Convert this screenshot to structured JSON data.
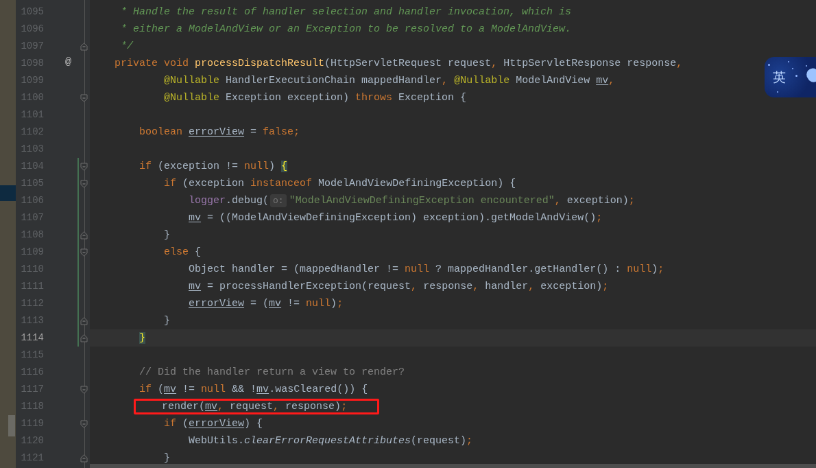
{
  "lines": [
    {
      "number": "1095",
      "tokens": [
        {
          "kind": "doc",
          "text": "     * Handle the result of handler selection and handler invocation, which is"
        }
      ]
    },
    {
      "number": "1096",
      "tokens": [
        {
          "kind": "doc",
          "text": "     * either a ModelAndView or an Exception to be resolved to a ModelAndView."
        }
      ]
    },
    {
      "number": "1097",
      "fold": {
        "kind": "end"
      },
      "tokens": [
        {
          "kind": "doc",
          "text": "     */"
        }
      ]
    },
    {
      "number": "1098",
      "marker": "@",
      "tokens": [
        {
          "kind": "keyword",
          "text": "    private void "
        },
        {
          "kind": "method",
          "text": "processDispatchResult"
        },
        {
          "kind": "plain",
          "text": "(HttpServletRequest request"
        },
        {
          "kind": "keyword",
          "text": ", "
        },
        {
          "kind": "plain",
          "text": "HttpServletResponse response"
        },
        {
          "kind": "keyword",
          "text": ","
        }
      ]
    },
    {
      "number": "1099",
      "tokens": [
        {
          "kind": "annotation",
          "text": "            @Nullable "
        },
        {
          "kind": "plain",
          "text": "HandlerExecutionChain mappedHandler"
        },
        {
          "kind": "keyword",
          "text": ", "
        },
        {
          "kind": "annotation",
          "text": "@Nullable "
        },
        {
          "kind": "plain",
          "text": "ModelAndView "
        },
        {
          "kind": "variable",
          "text": "mv"
        },
        {
          "kind": "keyword",
          "text": ","
        }
      ]
    },
    {
      "number": "1100",
      "fold": {
        "kind": "start"
      },
      "tokens": [
        {
          "kind": "annotation",
          "text": "            @Nullable "
        },
        {
          "kind": "plain",
          "text": "Exception exception) "
        },
        {
          "kind": "keyword",
          "text": "throws "
        },
        {
          "kind": "plain",
          "text": "Exception {"
        }
      ]
    },
    {
      "number": "1101"
    },
    {
      "number": "1102",
      "tokens": [
        {
          "kind": "keyword",
          "text": "        boolean "
        },
        {
          "kind": "variable",
          "text": "errorView"
        },
        {
          "kind": "plain",
          "text": " = "
        },
        {
          "kind": "keyword",
          "text": "false;"
        }
      ]
    },
    {
      "number": "1103"
    },
    {
      "number": "1104",
      "fold": {
        "kind": "start"
      },
      "changed": true,
      "tokens": [
        {
          "kind": "keyword",
          "text": "        if "
        },
        {
          "kind": "plain",
          "text": "(exception != "
        },
        {
          "kind": "keyword",
          "text": "null"
        },
        {
          "kind": "plain",
          "text": ") "
        },
        {
          "kind": "brace",
          "text": "{"
        }
      ]
    },
    {
      "number": "1105",
      "fold": {
        "kind": "start"
      },
      "changed": true,
      "tokens": [
        {
          "kind": "keyword",
          "text": "            if "
        },
        {
          "kind": "plain",
          "text": "(exception "
        },
        {
          "kind": "keyword",
          "text": "instanceof "
        },
        {
          "kind": "plain",
          "text": "ModelAndViewDefiningException) {"
        }
      ]
    },
    {
      "number": "1106",
      "changed": true,
      "tokens": [
        {
          "kind": "field",
          "text": "                logger"
        },
        {
          "kind": "plain",
          "text": ".debug("
        },
        {
          "kind": "hint",
          "text": "o:"
        },
        {
          "kind": "string",
          "text": "\"ModelAndViewDefiningException encountered\""
        },
        {
          "kind": "keyword",
          "text": ", "
        },
        {
          "kind": "plain",
          "text": "exception)"
        },
        {
          "kind": "keyword",
          "text": ";"
        }
      ]
    },
    {
      "number": "1107",
      "changed": true,
      "tokens": [
        {
          "kind": "variable",
          "text": "                mv"
        },
        {
          "kind": "plain",
          "text": " = ((ModelAndViewDefiningException) exception).getModelAndView()"
        },
        {
          "kind": "keyword",
          "text": ";"
        }
      ]
    },
    {
      "number": "1108",
      "fold": {
        "kind": "end"
      },
      "changed": true,
      "tokens": [
        {
          "kind": "plain",
          "text": "            }"
        }
      ]
    },
    {
      "number": "1109",
      "fold": {
        "kind": "start"
      },
      "changed": true,
      "tokens": [
        {
          "kind": "keyword",
          "text": "            else "
        },
        {
          "kind": "plain",
          "text": "{"
        }
      ]
    },
    {
      "number": "1110",
      "changed": true,
      "tokens": [
        {
          "kind": "plain",
          "text": "                Object handler = (mappedHandler != "
        },
        {
          "kind": "keyword",
          "text": "null "
        },
        {
          "kind": "plain",
          "text": "? mappedHandler.getHandler() : "
        },
        {
          "kind": "keyword",
          "text": "null"
        },
        {
          "kind": "plain",
          "text": ")"
        },
        {
          "kind": "keyword",
          "text": ";"
        }
      ]
    },
    {
      "number": "1111",
      "changed": true,
      "tokens": [
        {
          "kind": "variable",
          "text": "                mv"
        },
        {
          "kind": "plain",
          "text": " = processHandlerException(request"
        },
        {
          "kind": "keyword",
          "text": ", "
        },
        {
          "kind": "plain",
          "text": "response"
        },
        {
          "kind": "keyword",
          "text": ", "
        },
        {
          "kind": "plain",
          "text": "handler"
        },
        {
          "kind": "keyword",
          "text": ", "
        },
        {
          "kind": "plain",
          "text": "exception)"
        },
        {
          "kind": "keyword",
          "text": ";"
        }
      ]
    },
    {
      "number": "1112",
      "changed": true,
      "tokens": [
        {
          "kind": "variable",
          "text": "                errorView"
        },
        {
          "kind": "plain",
          "text": " = ("
        },
        {
          "kind": "variable",
          "text": "mv"
        },
        {
          "kind": "plain",
          "text": " != "
        },
        {
          "kind": "keyword",
          "text": "null"
        },
        {
          "kind": "plain",
          "text": ")"
        },
        {
          "kind": "keyword",
          "text": ";"
        }
      ]
    },
    {
      "number": "1113",
      "fold": {
        "kind": "end"
      },
      "changed": true,
      "tokens": [
        {
          "kind": "plain",
          "text": "            }"
        }
      ]
    },
    {
      "number": "1114",
      "fold": {
        "kind": "end"
      },
      "changed": true,
      "current": true,
      "tokens": [
        {
          "kind": "brace",
          "text": "        }"
        }
      ]
    },
    {
      "number": "1115"
    },
    {
      "number": "1116",
      "tokens": [
        {
          "kind": "comment",
          "text": "        // Did the handler return a view to render?"
        }
      ]
    },
    {
      "number": "1117",
      "fold": {
        "kind": "start"
      },
      "tokens": [
        {
          "kind": "keyword",
          "text": "        if "
        },
        {
          "kind": "plain",
          "text": "("
        },
        {
          "kind": "variable",
          "text": "mv"
        },
        {
          "kind": "plain",
          "text": " != "
        },
        {
          "kind": "keyword",
          "text": "null "
        },
        {
          "kind": "plain",
          "text": "&& !"
        },
        {
          "kind": "variable",
          "text": "mv"
        },
        {
          "kind": "plain",
          "text": ".wasCleared()) {"
        }
      ]
    },
    {
      "number": "1118",
      "boxed": true,
      "tokens": [
        {
          "kind": "plain",
          "text": "            render("
        },
        {
          "kind": "variable",
          "text": "mv"
        },
        {
          "kind": "keyword",
          "text": ", "
        },
        {
          "kind": "plain",
          "text": "request"
        },
        {
          "kind": "keyword",
          "text": ", "
        },
        {
          "kind": "plain",
          "text": "response)"
        },
        {
          "kind": "keyword",
          "text": ";"
        }
      ]
    },
    {
      "number": "1119",
      "fold": {
        "kind": "start"
      },
      "tokens": [
        {
          "kind": "keyword",
          "text": "            if "
        },
        {
          "kind": "plain",
          "text": "("
        },
        {
          "kind": "variable",
          "text": "errorView"
        },
        {
          "kind": "plain",
          "text": ") {"
        }
      ]
    },
    {
      "number": "1120",
      "tokens": [
        {
          "kind": "plain",
          "text": "                WebUtils."
        },
        {
          "kind": "static",
          "text": "clearErrorRequestAttributes"
        },
        {
          "kind": "plain",
          "text": "(request)"
        },
        {
          "kind": "keyword",
          "text": ";"
        }
      ]
    },
    {
      "number": "1121",
      "fold": {
        "kind": "end"
      },
      "tokens": [
        {
          "kind": "plain",
          "text": "            }"
        }
      ]
    }
  ],
  "ime": {
    "label": "英"
  }
}
